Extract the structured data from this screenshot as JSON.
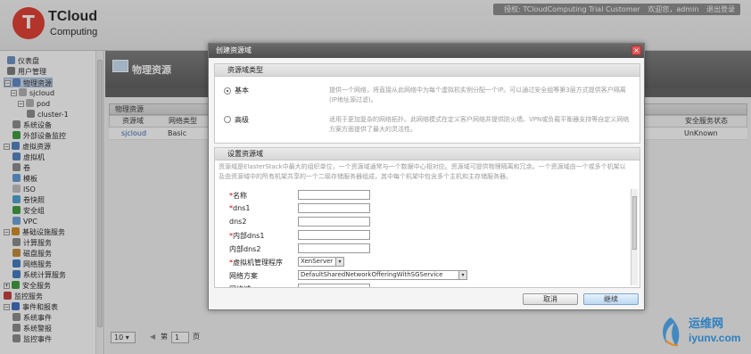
{
  "brand": {
    "logo_letter": "T",
    "name_line1": "TCloud",
    "name_line2": "Computing"
  },
  "header": {
    "license": "授权: TCloudComputing Trial Customer",
    "welcome": "欢迎您，admin",
    "logout": "退出登录"
  },
  "sidebar": {
    "items": [
      {
        "label": "仪表盘",
        "color": "#6a8fc0"
      },
      {
        "label": "用户管理",
        "color": "#7a7a7a"
      },
      {
        "label": "物理资源",
        "color": "#5b86c4",
        "toggle": "−"
      },
      {
        "label": "sjcloud",
        "color": "#b0b0b0",
        "toggle": "−"
      },
      {
        "label": "pod",
        "color": "#b0b0b0",
        "toggle": "−"
      },
      {
        "label": "cluster-1",
        "color": "#8a8a8a"
      },
      {
        "label": "系统设备",
        "color": "#8a8a8a"
      },
      {
        "label": "外部设备监控",
        "color": "#3a9a3a"
      },
      {
        "label": "虚拟资源",
        "color": "#4f7fbf",
        "toggle": "−"
      },
      {
        "label": "虚拟机",
        "color": "#4f7fbf"
      },
      {
        "label": "卷",
        "color": "#888"
      },
      {
        "label": "模板",
        "color": "#5a9ad6"
      },
      {
        "label": "ISO",
        "color": "#c0c0c0"
      },
      {
        "label": "卷快照",
        "color": "#4aa0d0"
      },
      {
        "label": "安全组",
        "color": "#3a9a3a"
      },
      {
        "label": "VPC",
        "color": "#6aa0d6"
      },
      {
        "label": "基础设施服务",
        "color": "#d08a20",
        "toggle": "−"
      },
      {
        "label": "计算服务",
        "color": "#888"
      },
      {
        "label": "磁盘服务",
        "color": "#c08a30"
      },
      {
        "label": "网络服务",
        "color": "#3a7ac0"
      },
      {
        "label": "系统计算服务",
        "color": "#3a7ac0"
      },
      {
        "label": "安全服务",
        "color": "#3a9a3a",
        "toggle": "+"
      },
      {
        "label": "监控服务",
        "color": "#c03a3a"
      },
      {
        "label": "事件和报表",
        "color": "#3a6ac0",
        "toggle": "−"
      },
      {
        "label": "系统事件",
        "color": "#888"
      },
      {
        "label": "系统警报",
        "color": "#888"
      },
      {
        "label": "监控事件",
        "color": "#888"
      }
    ]
  },
  "page": {
    "title": "物理资源",
    "panel_title": "物理资源"
  },
  "grid": {
    "headers": {
      "zone": "资源域",
      "network_type": "网络类型",
      "security": "安全服务状态"
    },
    "rows": [
      {
        "zone": "sjcloud",
        "network_type": "Basic",
        "security": "UnKnown"
      }
    ]
  },
  "pager": {
    "page_size": "10",
    "page_label": "第",
    "page_num": "1",
    "page_unit": "页"
  },
  "dialog": {
    "title": "创建资源域",
    "close_glyph": "×",
    "zone_type": {
      "title": "资源域类型",
      "basic_label": "基本",
      "basic_desc": "提供一个网络，将直接从此网络中为每个虚拟机实例分配一个IP。可以通过安全组等第3层方式提供客户隔离(IP地址源过滤)。",
      "advanced_label": "高级",
      "advanced_desc": "适用于更加复杂的网络拓扑。此网络模式在定义客户网络并提供防火墙、VPN或负载平衡器支持等自定义网络方案方面提供了最大的灵活性。"
    },
    "setup": {
      "title": "设置资源域",
      "description": "资源域是ElasterStack中最大的组织单位，一个资源域通常与一个数据中心相对应。资源域可提供物理隔离和冗余。一个资源域由一个或多个机架以及由资源域中的所有机架共享的一个二级存储服务器组成，其中每个机架中包含多个主机和主存储服务器。",
      "fields": [
        {
          "label": "名称",
          "required": true
        },
        {
          "label": "dns1",
          "required": true
        },
        {
          "label": "dns2",
          "required": false
        },
        {
          "label": "内部dns1",
          "required": true
        },
        {
          "label": "内部dns2",
          "required": false
        },
        {
          "label": "虚拟机管理程序",
          "required": true,
          "value": "XenServer"
        },
        {
          "label": "网络方案",
          "required": false,
          "value": "DefaultSharedNetworkOfferingWithSGService"
        },
        {
          "label": "网络域",
          "required": false
        }
      ]
    },
    "buttons": {
      "cancel": "取消",
      "next": "继续"
    }
  },
  "watermark": {
    "line1": "运维网",
    "line2": "iyunv.com"
  }
}
